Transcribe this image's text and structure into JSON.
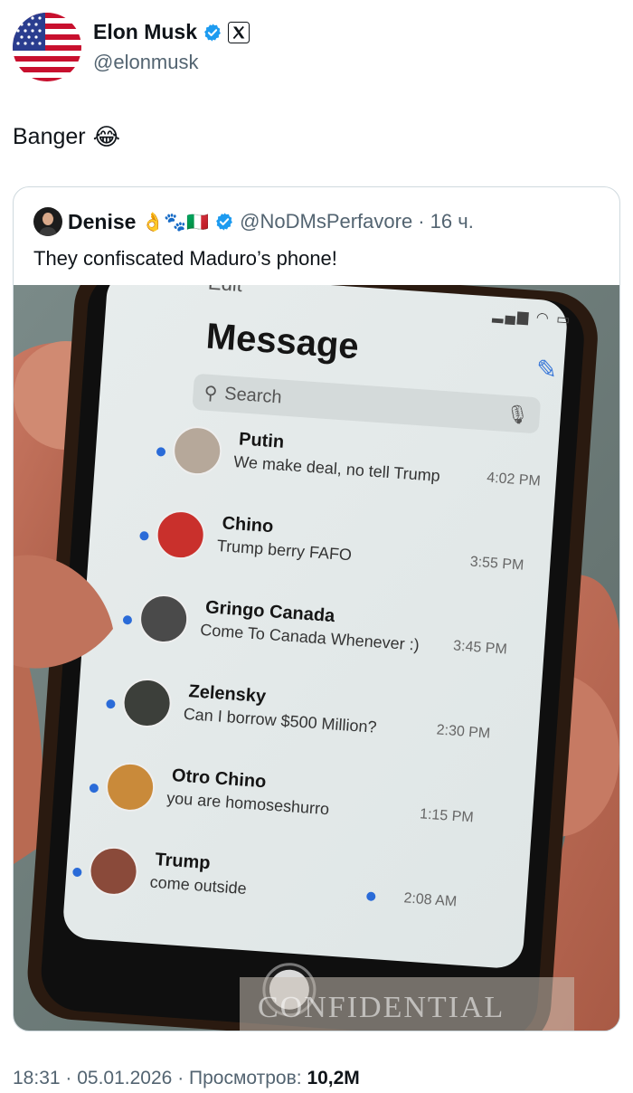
{
  "author": {
    "name": "Elon Musk",
    "handle": "@elonmusk",
    "avatar_icon": "us-flag-icon",
    "verified_icon": "verified-badge-icon",
    "affiliate_icon": "x-logo-icon"
  },
  "post": {
    "text": "Banger",
    "emoji": "😂"
  },
  "quote": {
    "name": "Denise",
    "name_emojis": "👌🐾🇮🇹",
    "handle": "@NoDMsPerfavore",
    "time": "· 16 ч.",
    "text": "They confiscated Maduro’s phone!",
    "image": {
      "status_back": "Edit",
      "title": "Message",
      "search_placeholder": "Search",
      "watermark": "CONFIDENTIAL",
      "messages": [
        {
          "name": "Putin",
          "text": "We make deal, no tell Trump",
          "time": "4:02 PM",
          "unread": true
        },
        {
          "name": "Chino",
          "text": "Trump berry FAFO",
          "time": "3:55 PM",
          "unread": true
        },
        {
          "name": "Gringo Canada",
          "text": "Come To Canada Whenever :)",
          "time": "3:45 PM",
          "unread": true
        },
        {
          "name": "Zelensky",
          "text": "Can I borrow $500 Million?",
          "time": "2:30 PM",
          "unread": true
        },
        {
          "name": "Otro Chino",
          "text": "you are homoseshurro",
          "time": "1:15 PM",
          "unread": true
        },
        {
          "name": "Trump",
          "text": "come outside",
          "time": "2:08 AM",
          "unread": true
        }
      ]
    }
  },
  "footer": {
    "time": "18:31",
    "date": "05.01.2026",
    "views_label": "Просмотров:",
    "views": "10,2M"
  },
  "colors": {
    "verified": "#1d9bf0",
    "text": "#0f1419",
    "secondary": "#536471",
    "unread_dot": "#2a6bd8"
  }
}
